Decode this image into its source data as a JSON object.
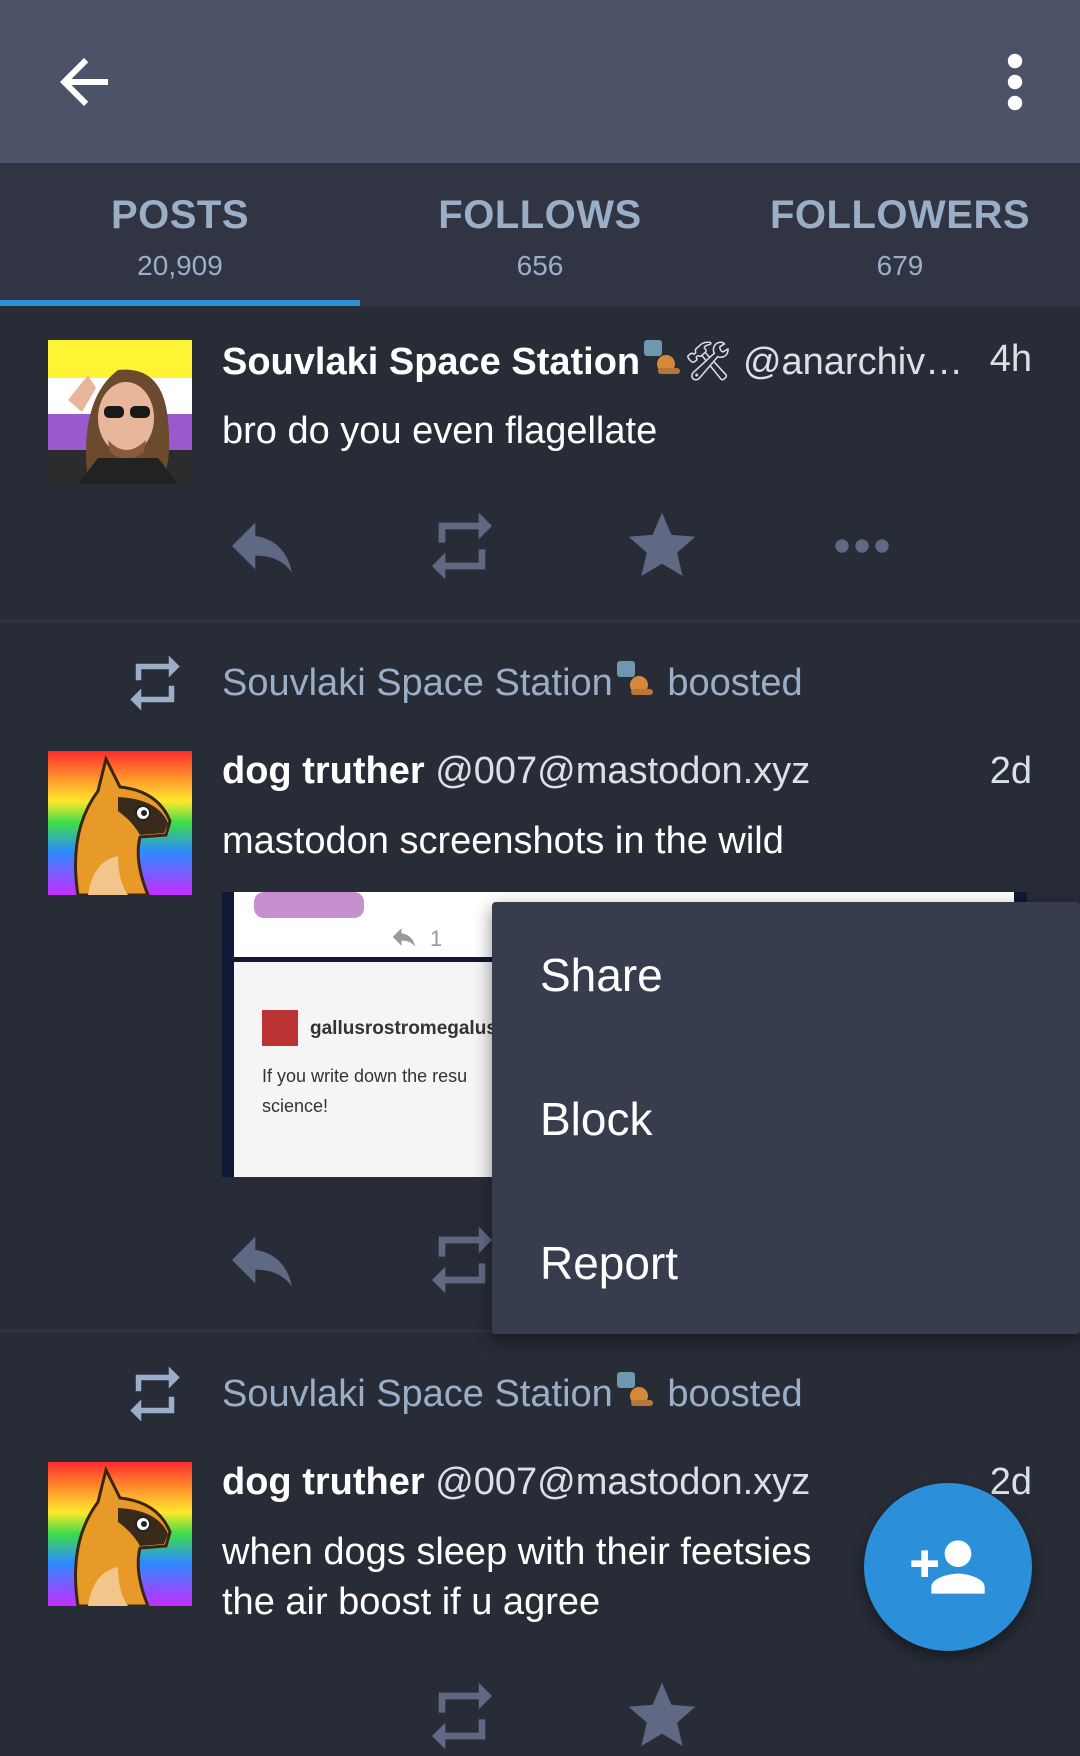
{
  "appbar": {
    "back_icon": "arrow-left-icon",
    "menu_icon": "more-vert-icon"
  },
  "tabs": [
    {
      "label": "POSTS",
      "count": "20,909"
    },
    {
      "label": "FOLLOWS",
      "count": "656"
    },
    {
      "label": "FOLLOWERS",
      "count": "679"
    }
  ],
  "statuses": [
    {
      "display_name": "Souvlaki Space Station",
      "emoji_suffix": "🛠",
      "acct": "@anarchiv…",
      "time": "4h",
      "content": "bro do you even flagellate"
    },
    {
      "boosted_by": "Souvlaki Space Station",
      "boosted_suffix": " boosted",
      "display_name": "dog truther",
      "acct": "@007@mastodon.xyz",
      "time": "2d",
      "content": "mastodon screenshots in the wild",
      "media_text": {
        "count": "1",
        "name": "gallusrostromegalus",
        "line1": "If you write down the resu",
        "line2": "science!"
      }
    },
    {
      "boosted_by": "Souvlaki Space Station",
      "boosted_suffix": " boosted",
      "display_name": "dog truther",
      "acct": "@007@mastodon.xyz",
      "time": "2d",
      "content_line1": "when dogs sleep with their feetsies",
      "content_line2": "the air boost if u agree"
    }
  ],
  "menu": {
    "items": [
      "Share",
      "Block",
      "Report"
    ]
  },
  "fab": {
    "icon": "person-add-icon"
  },
  "colors": {
    "accent": "#2b90d9",
    "bg": "#282c37",
    "appbar": "#4c5368",
    "icon": "#606984",
    "muted": "#9baec8"
  }
}
